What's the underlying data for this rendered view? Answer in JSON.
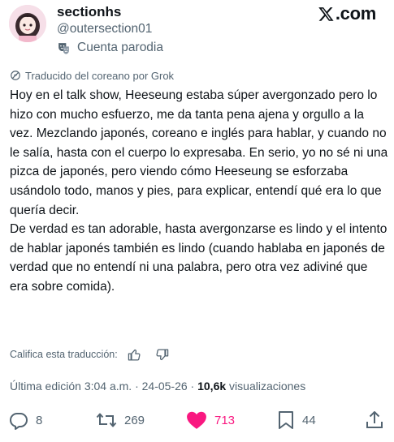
{
  "author": {
    "display_name": "sectionhs",
    "handle": "@outersection01",
    "parody_label": "Cuenta parodia"
  },
  "brand": {
    "logo_text": ".com"
  },
  "translation": {
    "label": "Traducido del coreano por Grok"
  },
  "post": {
    "paragraph_1": "Hoy en el talk show, Heeseung estaba súper avergonzado pero lo hizo con mucho esfuerzo, me da tanta pena ajena y orgullo a la vez. Mezclando japonés, coreano e inglés para hablar, y cuando no le salía, hasta con el cuerpo lo expresaba. En serio, yo no sé ni una pizca de japonés, pero viendo cómo Heeseung se esforzaba usándolo todo, manos y pies, para explicar, entendí qué era lo que quería decir.",
    "paragraph_2": "De verdad es tan adorable, hasta avergonzarse es lindo y el intento de hablar japonés también es lindo (cuando hablaba en japonés de verdad que no entendí ni una palabra, pero otra vez adiviné que era sobre comida)."
  },
  "rate_translation": {
    "label": "Califica esta traducción:"
  },
  "meta": {
    "edited": "Última edición 3:04 a.m. · 24-05-26 · ",
    "views_count": "10,6k",
    "views_label": " visualizaciones"
  },
  "actions": {
    "replies": "8",
    "reposts": "269",
    "likes": "713",
    "bookmarks": "44"
  },
  "colors": {
    "like": "#f91880",
    "secondary_text": "#536471",
    "primary_text": "#0f1419"
  }
}
